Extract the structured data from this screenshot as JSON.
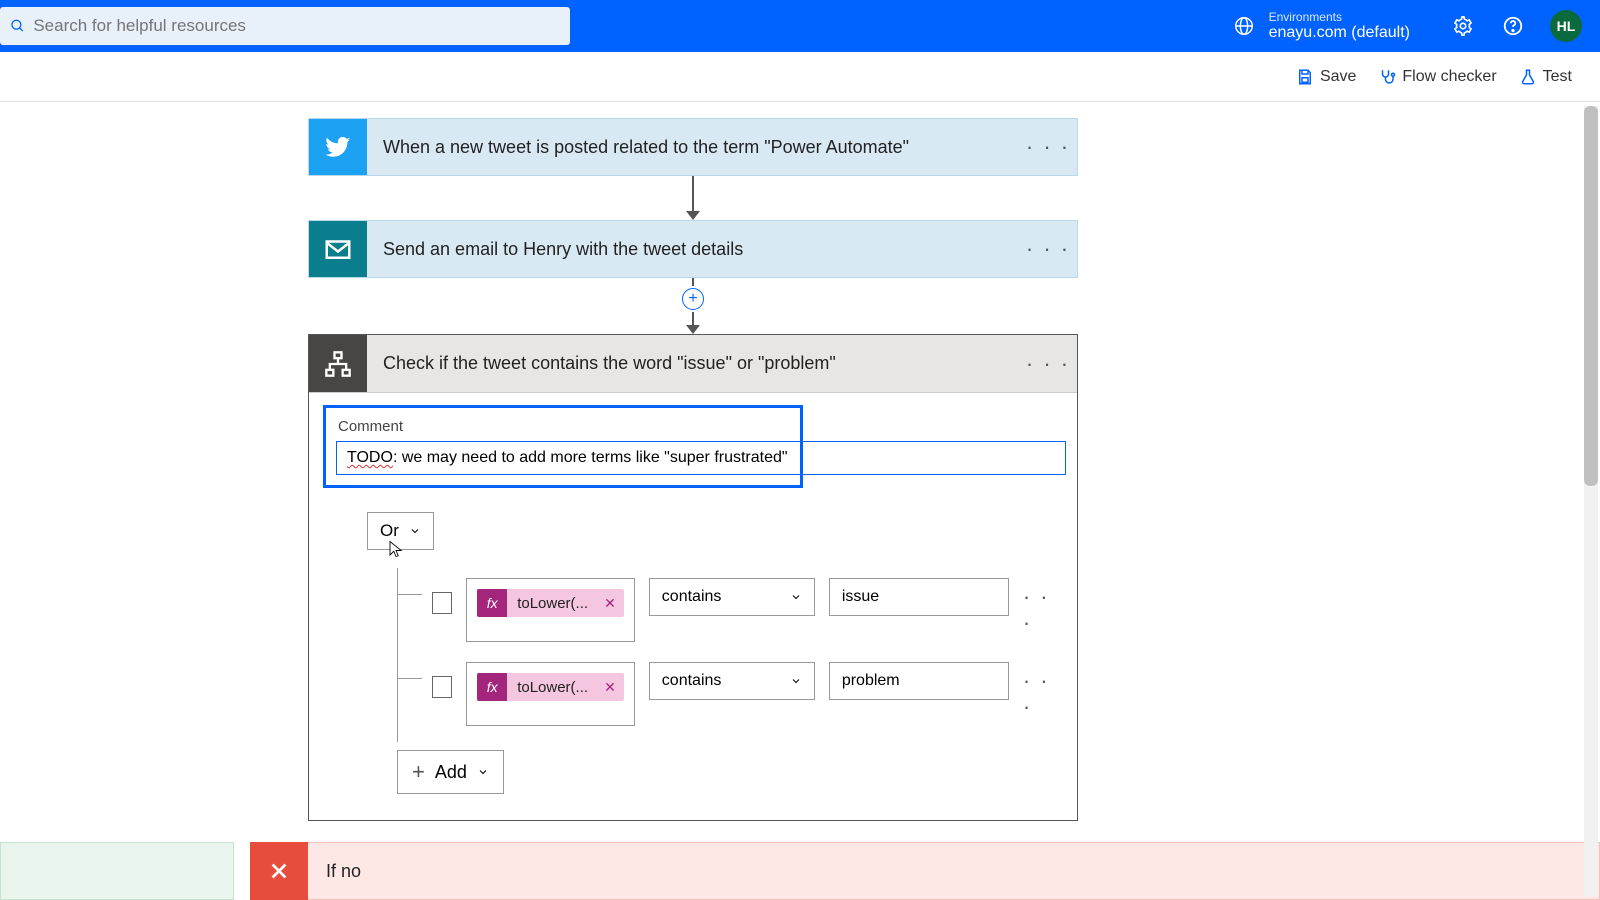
{
  "topbar": {
    "search_placeholder": "Search for helpful resources",
    "env_label": "Environments",
    "env_name": "enayu.com (default)",
    "avatar": "HL"
  },
  "toolbar": {
    "save": "Save",
    "flow_checker": "Flow checker",
    "test": "Test"
  },
  "steps": {
    "trigger": "When a new tweet is posted related to the term \"Power Automate\"",
    "email": "Send an email to Henry with the tweet details",
    "condition": "Check if the tweet contains the word \"issue\" or \"problem\""
  },
  "comment": {
    "label": "Comment",
    "todo": "TODO",
    "rest": ": we may need to add more terms like \"super frustrated\""
  },
  "group_op": "Or",
  "rules": [
    {
      "fx": "toLower(...",
      "op": "contains",
      "value": "issue"
    },
    {
      "fx": "toLower(...",
      "op": "contains",
      "value": "problem"
    }
  ],
  "add_label": "Add",
  "branches": {
    "if_no": "If no"
  },
  "icons": {
    "dots": "· · ·"
  }
}
